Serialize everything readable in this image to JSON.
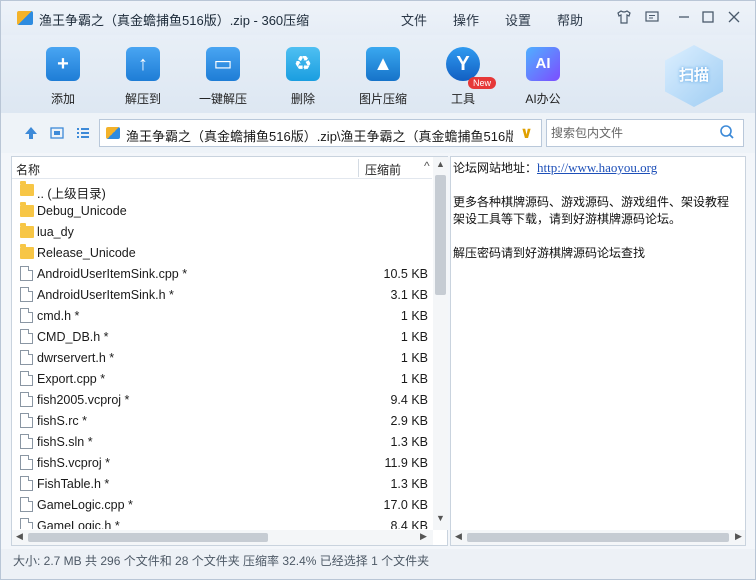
{
  "window": {
    "title": "渔王争霸之（真金蟾捕鱼516版）.zip - 360压缩",
    "menu": [
      "文件",
      "操作",
      "设置",
      "帮助"
    ],
    "title_icons": [
      "shirt-icon",
      "feedback-icon",
      "minimize-icon",
      "maximize-icon",
      "close-icon"
    ]
  },
  "toolbar": {
    "items": [
      {
        "label": "添加",
        "icon": "add-icon"
      },
      {
        "label": "解压到",
        "icon": "extract-to-icon"
      },
      {
        "label": "一键解压",
        "icon": "one-click-extract-icon"
      },
      {
        "label": "删除",
        "icon": "delete-icon"
      },
      {
        "label": "图片压缩",
        "icon": "image-compress-icon"
      },
      {
        "label": "工具",
        "icon": "tools-icon"
      },
      {
        "label": "AI办公",
        "icon": "ai-office-icon"
      }
    ],
    "new_badge": "New",
    "scan_label": "扫描"
  },
  "address": {
    "path": "渔王争霸之（真金蟾捕鱼516版）.zip\\渔王争霸之（真金蟾捕鱼516版",
    "search_placeholder": "搜索包内文件"
  },
  "file_list": {
    "col_name": "名称",
    "col_size": "压缩前",
    "rows": [
      {
        "type": "folder",
        "name": ".. (上级目录)",
        "size": ""
      },
      {
        "type": "folder",
        "name": "Debug_Unicode",
        "size": ""
      },
      {
        "type": "folder",
        "name": "lua_dy",
        "size": ""
      },
      {
        "type": "folder",
        "name": "Release_Unicode",
        "size": ""
      },
      {
        "type": "file",
        "name": "AndroidUserItemSink.cpp *",
        "size": "10.5 KB"
      },
      {
        "type": "file",
        "name": "AndroidUserItemSink.h *",
        "size": "3.1 KB"
      },
      {
        "type": "file",
        "name": "cmd.h *",
        "size": "1 KB"
      },
      {
        "type": "file",
        "name": "CMD_DB.h *",
        "size": "1 KB"
      },
      {
        "type": "file",
        "name": "dwrservert.h *",
        "size": "1 KB"
      },
      {
        "type": "file",
        "name": "Export.cpp *",
        "size": "1 KB"
      },
      {
        "type": "file",
        "name": "fish2005.vcproj *",
        "size": "9.4 KB"
      },
      {
        "type": "file",
        "name": "fishS.rc *",
        "size": "2.9 KB"
      },
      {
        "type": "file",
        "name": "fishS.sln *",
        "size": "1.3 KB"
      },
      {
        "type": "file",
        "name": "fishS.vcproj *",
        "size": "11.9 KB"
      },
      {
        "type": "file",
        "name": "FishTable.h *",
        "size": "1.3 KB"
      },
      {
        "type": "file",
        "name": "GameLogic.cpp *",
        "size": "17.0 KB"
      },
      {
        "type": "file",
        "name": "GameLogic.h *",
        "size": "8.4 KB"
      }
    ]
  },
  "note": {
    "line1_label": "论坛网站地址：",
    "line1_link": "http://www.haoyou.org",
    "line2": "更多各种棋牌源码、游戏源码、游戏组件、架设教程",
    "line3": "架设工具等下载，请到好游棋牌源码论坛。",
    "line4": "解压密码请到好游棋牌源码论坛查找"
  },
  "status": {
    "text": "大小: 2.7 MB 共 296 个文件和 28 个文件夹 压缩率 32.4% 已经选择 1 个文件夹"
  }
}
